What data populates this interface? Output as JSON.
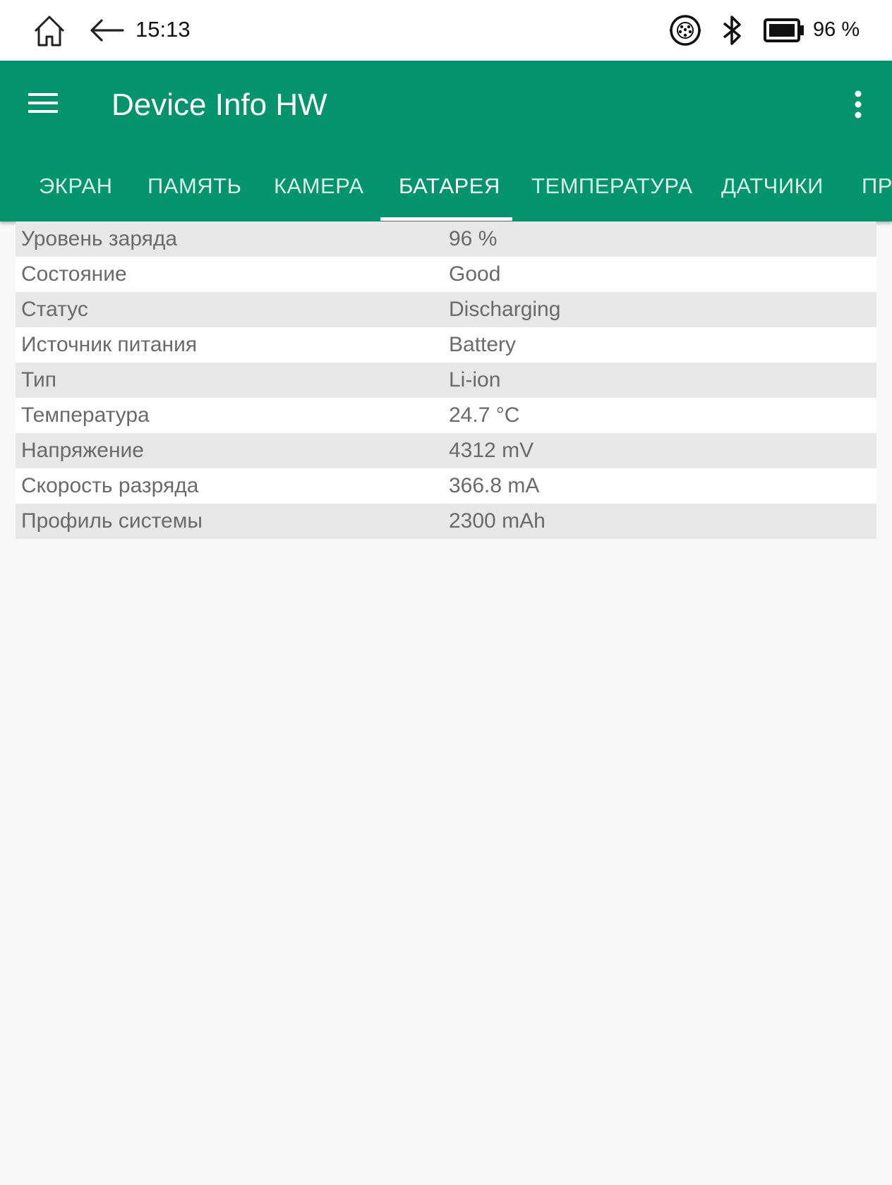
{
  "status_bar": {
    "time": "15:13",
    "battery_percent": "96 %",
    "icons": [
      "home-icon",
      "back-arrow-icon",
      "ebook-mode-icon",
      "bluetooth-icon",
      "battery-icon"
    ]
  },
  "app_bar": {
    "title": "Device Info HW",
    "color": "#03946e",
    "tabs": [
      {
        "label": "ЭКРАН"
      },
      {
        "label": "ПАМЯТЬ"
      },
      {
        "label": "КАМЕРА"
      },
      {
        "label": "БАТАРЕЯ"
      },
      {
        "label": "ТЕМПЕРАТУРА"
      },
      {
        "label": "ДАТЧИКИ"
      },
      {
        "label": "ПР"
      }
    ],
    "active_tab": "БАТАРЕЯ"
  },
  "battery_info": [
    {
      "key": "Уровень заряда",
      "value": "96 %"
    },
    {
      "key": "Состояние",
      "value": "Good"
    },
    {
      "key": "Статус",
      "value": "Discharging"
    },
    {
      "key": "Источник питания",
      "value": "Battery"
    },
    {
      "key": "Тип",
      "value": "Li-ion"
    },
    {
      "key": "Температура",
      "value": "24.7 °C"
    },
    {
      "key": "Напряжение",
      "value": "4312 mV"
    },
    {
      "key": "Скорость разряда",
      "value": "366.8 mA"
    },
    {
      "key": "Профиль системы",
      "value": "2300 mAh"
    }
  ]
}
